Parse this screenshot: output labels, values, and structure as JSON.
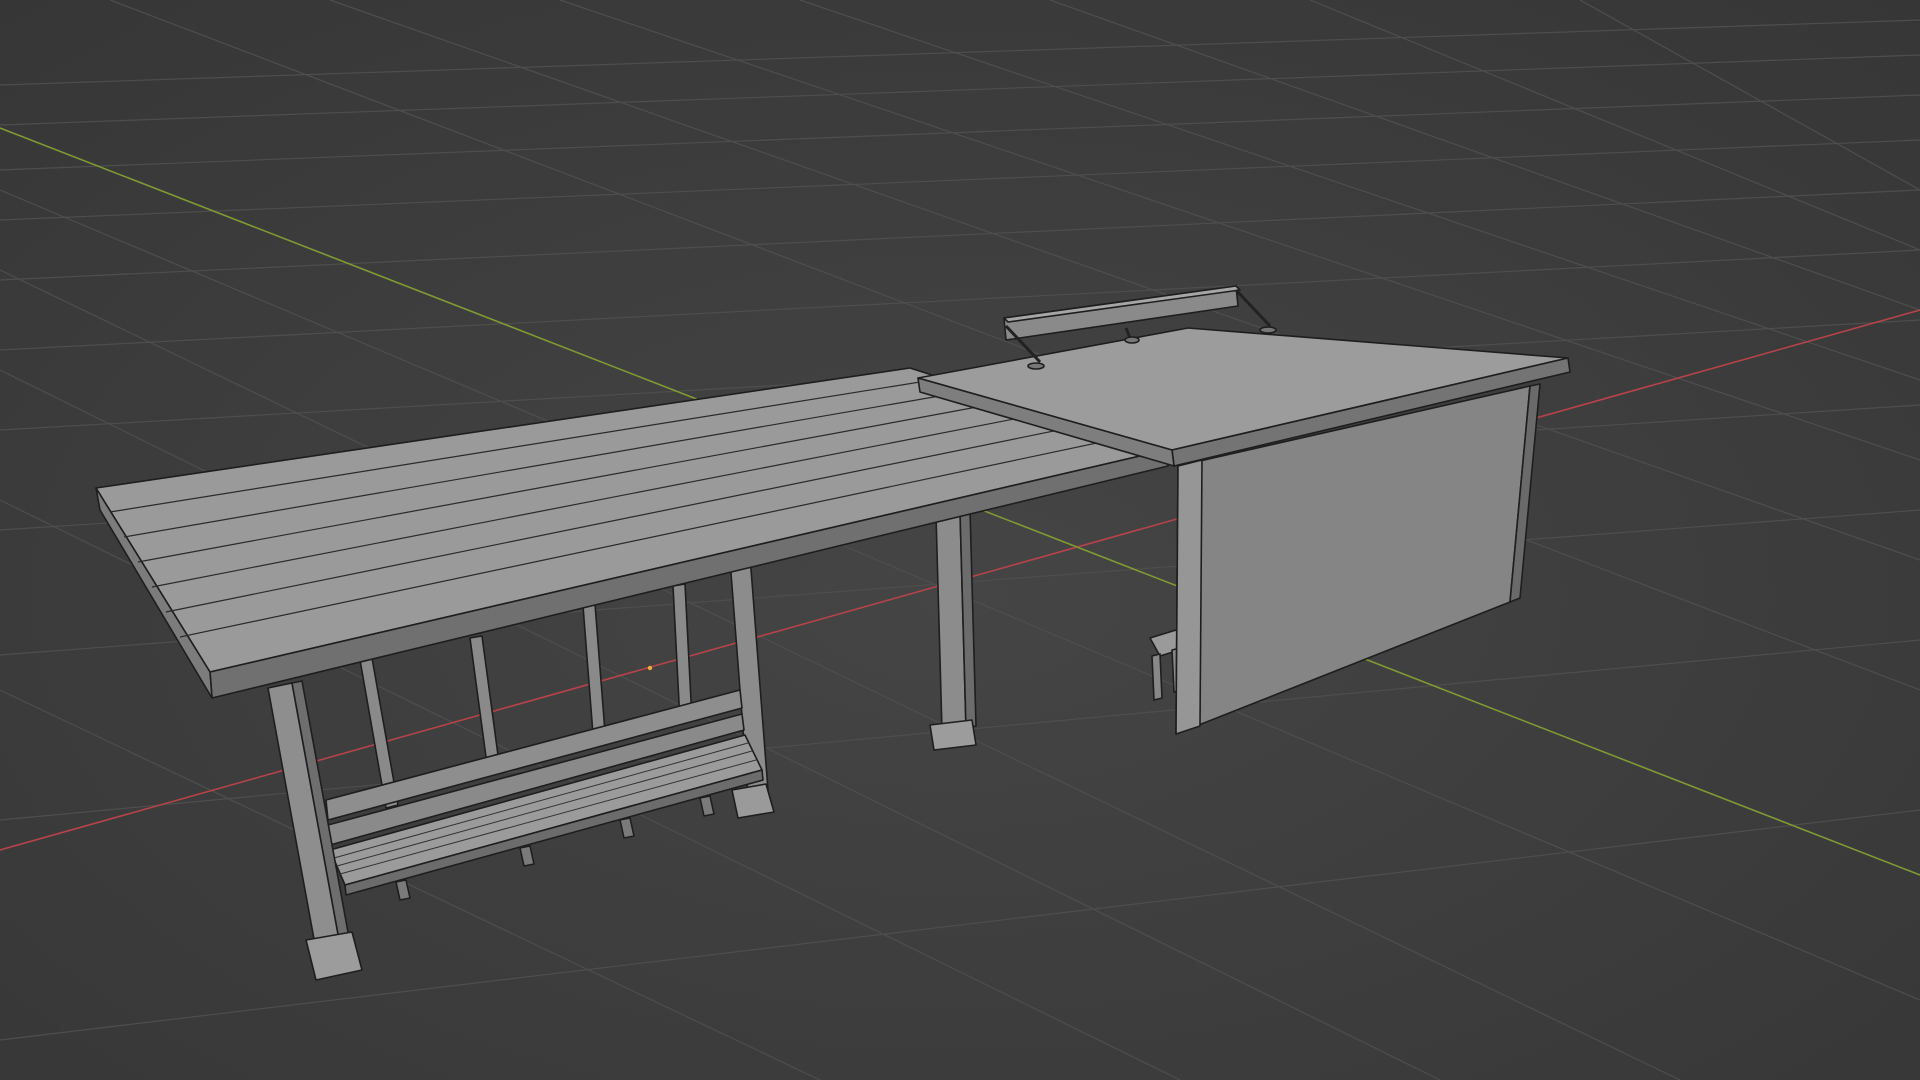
{
  "viewport": {
    "background": "#3d3d3d",
    "grid_color": "#4b4b4b",
    "x_axis_color": "#b64349",
    "y_axis_color": "#7f9a35",
    "mesh_fill_light": "#9a9a9a",
    "mesh_fill_mid": "#7d7d7d",
    "mesh_fill_dark": "#5f5f5f",
    "mesh_edge": "#1f1f1f",
    "origin_color": "#f2a93b",
    "show_grid": true
  },
  "scene": {
    "objects": [
      {
        "name": "bus-stop-shelter-with-bench"
      },
      {
        "name": "bus-stop-shelter-with-wall"
      }
    ]
  }
}
